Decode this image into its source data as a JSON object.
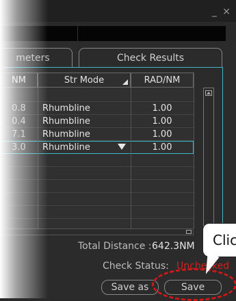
{
  "window": {
    "close_glyph": "_ ×"
  },
  "tabs": {
    "parameters": "meters",
    "check_results": "Check Results"
  },
  "table": {
    "headers": {
      "nm": "NM",
      "str_mode": "Str Mode",
      "rad_nm": "RAD/NM"
    },
    "rows": [
      {
        "nm": "",
        "mode": "",
        "rad": ""
      },
      {
        "nm": "0.8",
        "mode": "Rhumbline",
        "rad": "1.00"
      },
      {
        "nm": "0.4",
        "mode": "Rhumbline",
        "rad": "1.00"
      },
      {
        "nm": "7.1",
        "mode": "Rhumbline",
        "rad": "1.00"
      },
      {
        "nm": "3.0",
        "mode": "Rhumbline",
        "rad": "1.00"
      },
      {
        "nm": "",
        "mode": "",
        "rad": ""
      },
      {
        "nm": "",
        "mode": "",
        "rad": ""
      },
      {
        "nm": "",
        "mode": "",
        "rad": ""
      },
      {
        "nm": "",
        "mode": "",
        "rad": ""
      },
      {
        "nm": "",
        "mode": "",
        "rad": ""
      }
    ],
    "selected_row": 4
  },
  "summary": {
    "total_distance_label": "Total Distance :",
    "total_distance_value": "642.3NM",
    "check_status_label": "Check Status:",
    "check_status_value": "Unchecked"
  },
  "buttons": {
    "save_as": "Save as",
    "save": "Save"
  },
  "callout": {
    "text": "Click"
  },
  "colors": {
    "accent": "#39b8c8",
    "warning": "#d02020",
    "highlight": "#d01818"
  }
}
